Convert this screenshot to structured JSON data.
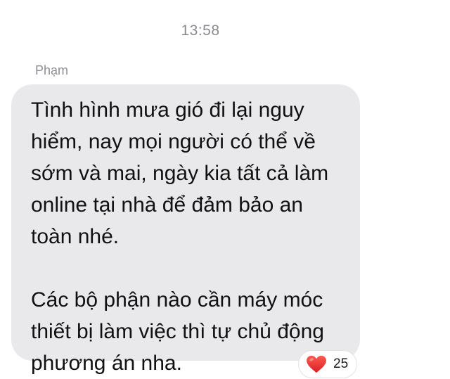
{
  "header": {
    "time": "13:58"
  },
  "message": {
    "sender": "Phạm",
    "paragraphs": [
      "Tình hình mưa gió đi lại nguy\nhiểm, nay mọi người có thể về\nsớm và mai, ngày kia tất cả làm\nonline tại nhà để đảm bảo an\ntoàn nhé.",
      "Các bộ phận nào cần máy móc\nthiết bị làm việc thì tự chủ động\nphương án nha."
    ],
    "reaction": {
      "icon": "heart-icon",
      "color": "#e8322f",
      "count": "25"
    }
  },
  "colors": {
    "bubble": "#e9e9eb",
    "text": "#111111",
    "meta": "#8e8e93"
  }
}
